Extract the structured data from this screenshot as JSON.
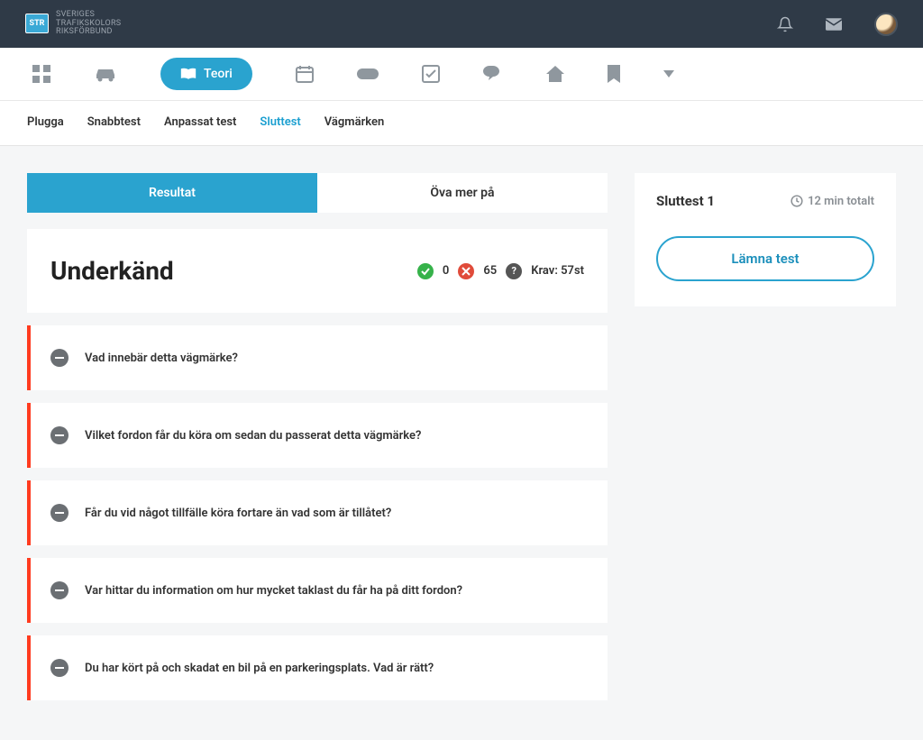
{
  "brand": {
    "abbr": "STR",
    "line1": "SVERIGES",
    "line2": "TRAFIKSKOLORS",
    "line3": "RIKSFÖRBUND"
  },
  "mainnav": {
    "teori_label": "Teori"
  },
  "subnav": {
    "items": [
      {
        "label": "Plugga",
        "active": false
      },
      {
        "label": "Snabbtest",
        "active": false
      },
      {
        "label": "Anpassat test",
        "active": false
      },
      {
        "label": "Sluttest",
        "active": true
      },
      {
        "label": "Vägmärken",
        "active": false
      }
    ]
  },
  "tabs": {
    "resultat": "Resultat",
    "ova": "Öva mer på"
  },
  "status": {
    "heading": "Underkänd",
    "correct": "0",
    "incorrect": "65",
    "krav_label": "Krav: 57st"
  },
  "questions": [
    {
      "text": "Vad innebär detta vägmärke?"
    },
    {
      "text": "Vilket fordon får du köra om sedan du passerat detta vägmärke?"
    },
    {
      "text": "Får du vid något tillfälle köra fortare än vad som är tillåtet?"
    },
    {
      "text": "Var hittar du information om hur mycket taklast du får ha på ditt fordon?"
    },
    {
      "text": "Du har kört på och skadat en bil på en parkeringsplats. Vad är rätt?"
    }
  ],
  "sidebar": {
    "title": "Sluttest 1",
    "time": "12 min totalt",
    "leave_label": "Lämna test"
  }
}
